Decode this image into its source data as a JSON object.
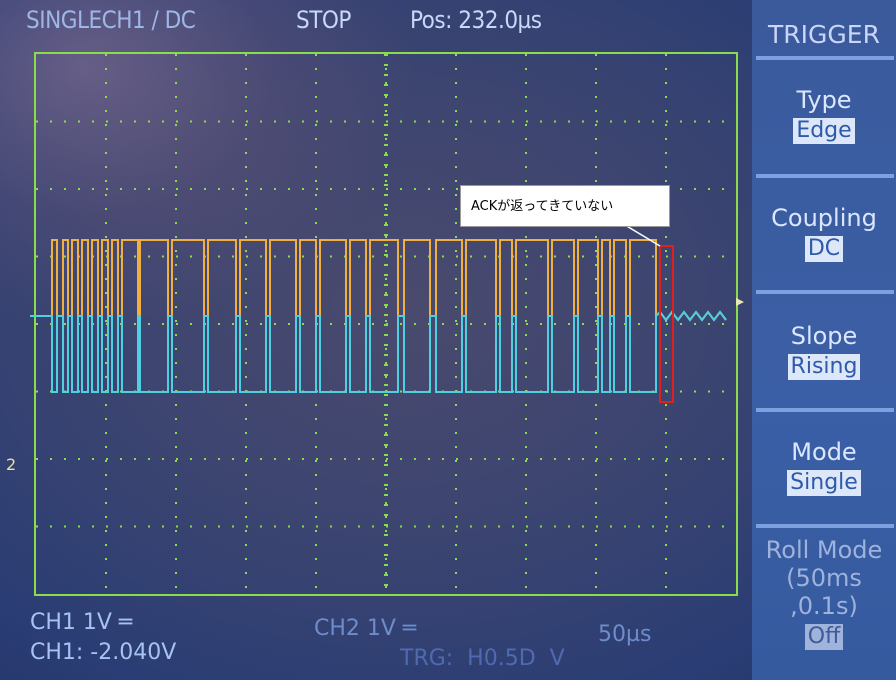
{
  "header": {
    "channel_mode": "SINGLECH1 ∕ DC",
    "run_state": "STOP",
    "position": "Pos: 232.0µs"
  },
  "trigger_menu": {
    "title": "TRIGGER",
    "items": [
      {
        "label": "Type",
        "value": "Edge"
      },
      {
        "label": "Coupling",
        "value": "DC"
      },
      {
        "label": "Slope",
        "value": "Rising"
      },
      {
        "label": "Mode",
        "value": "Single"
      },
      {
        "label": "Roll Mode",
        "sub": "(50ms ,0.1s)",
        "value": "Off"
      }
    ]
  },
  "footer": {
    "ch1_scale": "CH1  1V ═",
    "ch1_offset": "CH1: -2.040V",
    "ch2_scale": "CH2  1V ═",
    "timebase": "50µs",
    "trigger_status": "TRG:  H0.5D  V"
  },
  "annotation": {
    "text": "ACKが返ってきていない"
  },
  "ground_marker": "2",
  "colors": {
    "grid": "#8bdc4a",
    "trace_high": "#f0b040",
    "trace_low": "#4fd0e0",
    "highlight_box": "#e0201c"
  }
}
